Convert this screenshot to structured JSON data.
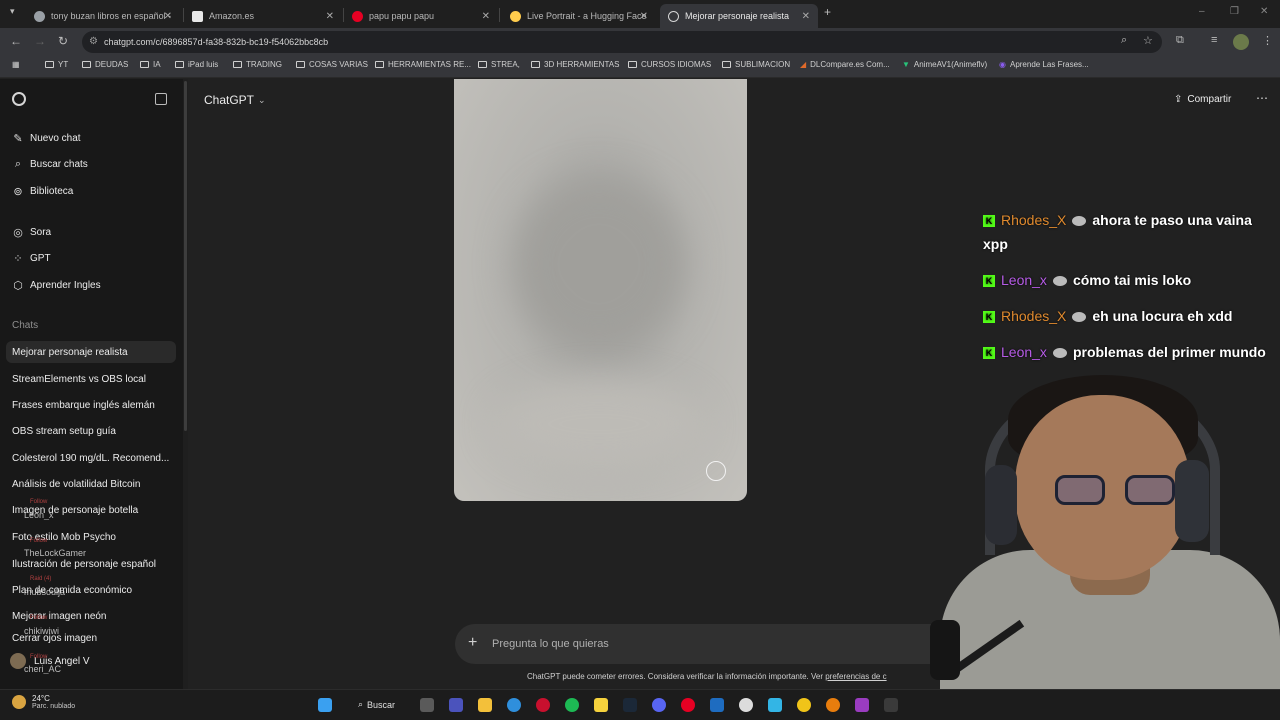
{
  "browser": {
    "tabs": [
      {
        "title": "tony buzan libros en español -",
        "fav_color": "#9aa0a6"
      },
      {
        "title": "Amazon.es",
        "fav_color": "#e8e8e8"
      },
      {
        "title": "papu papu papu",
        "fav_color": "#e60023"
      },
      {
        "title": "Live Portrait - a Hugging Face",
        "fav_color": "#ffcc4d"
      },
      {
        "title": "Mejorar personaje realista",
        "fav_color": "#d5d5d5"
      }
    ],
    "new_tab_glyph": "+",
    "url": "chatgpt.com/c/6896857d-fa38-832b-bc19-f54062bbc8cb",
    "bookmarks": [
      "YT",
      "DEUDAS",
      "IA",
      "iPad luis",
      "TRADING",
      "COSAS VARIAS",
      "HERRAMIENTAS RE...",
      "STREA,",
      "3D HERRAMIENTAS",
      "CURSOS IDIOMAS",
      "SUBLIMACION",
      "DLCompare.es Com...",
      "AnimeAV1(Animeflv)",
      "Aprende Las Frases..."
    ]
  },
  "sidebar": {
    "top_items": [
      {
        "label": "Nuevo chat",
        "icon": "edit-icon"
      },
      {
        "label": "Buscar chats",
        "icon": "search-icon"
      },
      {
        "label": "Biblioteca",
        "icon": "library-icon"
      }
    ],
    "tool_items": [
      {
        "label": "Sora",
        "icon": "sora-icon"
      },
      {
        "label": "GPT",
        "icon": "grid-icon"
      },
      {
        "label": "Aprender Ingles",
        "icon": "gpt-icon"
      }
    ],
    "chats_label": "Chats",
    "chats": [
      "Mejorar personaje realista",
      "StreamElements vs OBS local",
      "Frases embarque inglés alemán",
      "OBS stream setup guía",
      "Colesterol 190 mg/dL. Recomend...",
      "Análisis de volatilidad Bitcoin",
      "Imagen de personaje botella",
      "Foto estilo Mob Psycho",
      "Ilustración de personaje español",
      "Plan de comida económico",
      "Mejorar imagen neón",
      "Cerrar ojos imagen"
    ],
    "user_name": "Luis Angel V"
  },
  "main": {
    "model_label": "ChatGPT",
    "share_label": "Compartir",
    "composer_placeholder": "Pregunta lo que quieras",
    "disclaimer_text": "ChatGPT puede cometer errores. Considera verificar la información importante. Ver ",
    "disclaimer_link": "preferencias de c"
  },
  "overlay": {
    "messages": [
      {
        "user": "Rhodes_X",
        "user_color": "#e08a2e",
        "text": "ahora te paso una vaina"
      },
      {
        "user": "",
        "user_color": "#ffffff",
        "text": "xpp"
      },
      {
        "user": "Leon_x",
        "user_color": "#b65ce6",
        "text": "cómo tai mis loko"
      },
      {
        "user": "Rhodes_X",
        "user_color": "#e08a2e",
        "text": "eh una locura eh xdd"
      },
      {
        "user": "Leon_x",
        "user_color": "#b65ce6",
        "text": "problemas del primer mundo"
      }
    ],
    "badge": "K",
    "events": [
      {
        "tag": "Follow",
        "name": "Leon_x"
      },
      {
        "tag": "Follow",
        "name": "TheLockGamer"
      },
      {
        "tag": "Raid (4)",
        "name": "mubsoulja"
      },
      {
        "tag": "Follow",
        "name": "chikiwiwi"
      },
      {
        "tag": "Follow",
        "name": "cheri_AC"
      }
    ]
  },
  "taskbar": {
    "temperature": "24°C",
    "weather": "Parc. nublado",
    "search_label": "Buscar"
  }
}
